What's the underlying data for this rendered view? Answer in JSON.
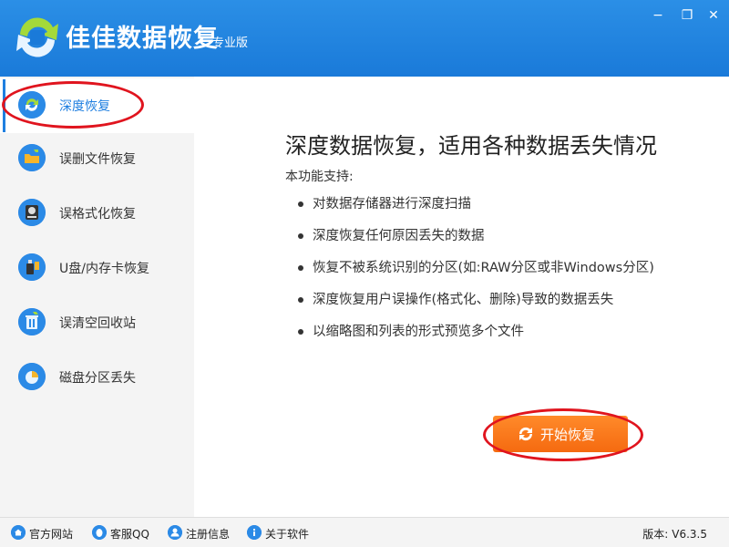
{
  "app": {
    "name": "佳佳数据恢复",
    "edition": "专业版"
  },
  "window": {
    "minimize": "−",
    "maximize": "❐",
    "close": "✕"
  },
  "sidebar": {
    "items": [
      {
        "label": "深度恢复",
        "icon": "refresh-icon",
        "active": true
      },
      {
        "label": "误删文件恢复",
        "icon": "folder-icon"
      },
      {
        "label": "误格式化恢复",
        "icon": "disk-icon"
      },
      {
        "label": "U盘/内存卡恢复",
        "icon": "usb-card-icon"
      },
      {
        "label": "误清空回收站",
        "icon": "recycle-bin-icon"
      },
      {
        "label": "磁盘分区丢失",
        "icon": "pie-chart-icon"
      }
    ]
  },
  "main": {
    "heading": "深度数据恢复，适用各种数据丢失情况",
    "support_title": "本功能支持:",
    "features": [
      "对数据存储器进行深度扫描",
      "深度恢复任何原因丢失的数据",
      "恢复不被系统识别的分区(如:RAW分区或非Windows分区)",
      "深度恢复用户误操作(格式化、删除)导致的数据丢失",
      "以缩略图和列表的形式预览多个文件"
    ],
    "start_button": "开始恢复"
  },
  "footer": {
    "links": [
      {
        "label": "官方网站",
        "icon": "home-icon"
      },
      {
        "label": "客服QQ",
        "icon": "qq-icon"
      },
      {
        "label": "注册信息",
        "icon": "user-icon"
      },
      {
        "label": "关于软件",
        "icon": "info-icon"
      }
    ],
    "version_label": "版本:",
    "version_value": "V6.3.5"
  },
  "colors": {
    "titlebar": "#1a7ad9",
    "accent": "#1f7fe0",
    "start_button": "#f56a10",
    "annotation": "#e0141e"
  }
}
